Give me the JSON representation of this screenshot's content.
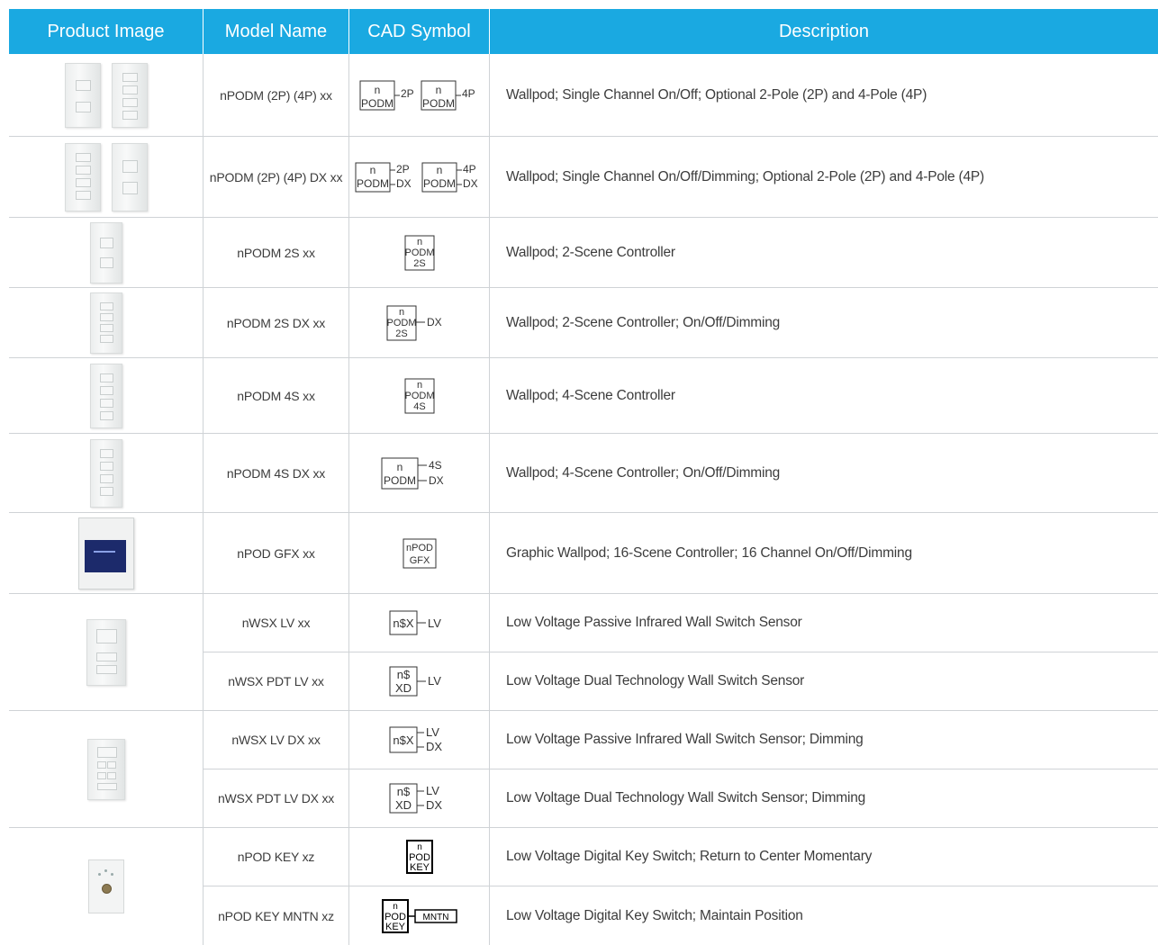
{
  "header": {
    "col_image": "Product Image",
    "col_model": "Model Name",
    "col_cad": "CAD Symbol",
    "col_desc": "Description"
  },
  "colors": {
    "header_bg": "#1aa9e1",
    "grid": "#cfd3d6"
  },
  "rows": [
    {
      "model": "nPODM (2P) (4P) xx",
      "desc": "Wallpod; Single Channel On/Off; Optional 2-Pole (2P) and 4-Pole (4P)",
      "cad": {
        "box1": "n",
        "box2": "PODM",
        "t1": "2P",
        "t2": "4P"
      }
    },
    {
      "model": "nPODM (2P) (4P) DX xx",
      "desc": "Wallpod; Single Channel On/Off/Dimming; Optional 2-Pole (2P) and 4-Pole (4P)",
      "cad": {
        "top": "n",
        "bot": "PODM",
        "a": "2P",
        "b": "DX",
        "c": "4P",
        "d": "DX"
      }
    },
    {
      "model": "nPODM 2S xx",
      "desc": "Wallpod; 2-Scene Controller",
      "cad": {
        "l1": "n",
        "l2": "PODM",
        "l3": "2S"
      }
    },
    {
      "model": "nPODM 2S DX xx",
      "desc": "Wallpod; 2-Scene Controller; On/Off/Dimming",
      "cad": {
        "l1": "n",
        "l2": "PODM",
        "l3": "2S",
        "side": "DX"
      }
    },
    {
      "model": "nPODM 4S xx",
      "desc": "Wallpod; 4-Scene Controller",
      "cad": {
        "l1": "n",
        "l2": "PODM",
        "l3": "4S"
      }
    },
    {
      "model": "nPODM 4S DX xx",
      "desc": "Wallpod; 4-Scene Controller; On/Off/Dimming",
      "cad": {
        "l1": "n",
        "l2": "PODM",
        "a": "4S",
        "b": "DX"
      }
    },
    {
      "model": "nPOD GFX xx",
      "desc": "Graphic Wallpod; 16-Scene Controller; 16 Channel On/Off/Dimming",
      "cad": {
        "l1": "nPOD",
        "l2": "GFX"
      }
    },
    {
      "model": "nWSX LV xx",
      "desc": "Low Voltage Passive Infrared Wall Switch Sensor",
      "cad": {
        "box": "n$X",
        "side": "LV"
      }
    },
    {
      "model": "nWSX PDT LV xx",
      "desc": "Low Voltage Dual Technology Wall Switch Sensor",
      "cad": {
        "l1": "n$",
        "l2": "XD",
        "side": "LV"
      }
    },
    {
      "model": "nWSX LV DX xx",
      "desc": "Low Voltage Passive Infrared Wall Switch Sensor; Dimming",
      "cad": {
        "box": "n$X",
        "a": "LV",
        "b": "DX"
      }
    },
    {
      "model": "nWSX PDT LV DX xx",
      "desc": "Low Voltage Dual Technology Wall Switch Sensor; Dimming",
      "cad": {
        "l1": "n$",
        "l2": "XD",
        "a": "LV",
        "b": "DX"
      }
    },
    {
      "model": "nPOD KEY xz",
      "desc": "Low Voltage Digital Key Switch; Return to Center Momentary",
      "cad": {
        "l1": "n",
        "l2": "POD",
        "l3": "KEY"
      }
    },
    {
      "model": "nPOD KEY MNTN xz",
      "desc": "Low Voltage Digital Key Switch; Maintain Position",
      "cad": {
        "l1": "n",
        "l2": "POD",
        "l3": "KEY",
        "side": "MNTN"
      }
    }
  ]
}
